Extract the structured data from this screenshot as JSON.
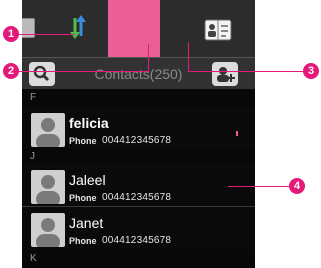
{
  "search_bar": {
    "title": "Contacts(250)"
  },
  "sections": [
    {
      "letter": "F"
    },
    {
      "letter": "J"
    },
    {
      "letter": "K"
    }
  ],
  "contacts": [
    {
      "name": "felicia",
      "phone_label": "Phone",
      "phone": "004412345678"
    },
    {
      "name": "Jaleel",
      "phone_label": "Phone",
      "phone": "004412345678"
    },
    {
      "name": "Janet",
      "phone_label": "Phone",
      "phone": "004412345678"
    }
  ],
  "callouts": {
    "c1": "1",
    "c2": "2",
    "c3": "3",
    "c4": "4"
  },
  "colors": {
    "accent": "#ea5f95",
    "callout": "#e4197a",
    "background": "#080808"
  },
  "icons": [
    "call-log-icon",
    "call-arrows-icon",
    "contacts-book-icon",
    "groups-icon",
    "search-icon",
    "add-contact-icon",
    "avatar-icon"
  ]
}
